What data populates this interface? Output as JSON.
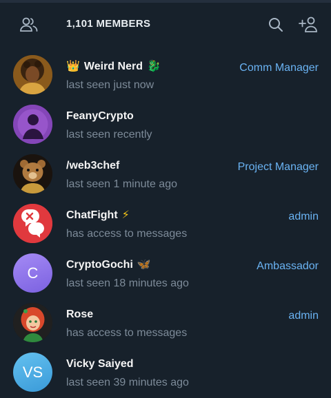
{
  "header": {
    "members_label": "1,101 MEMBERS",
    "icons": [
      "members-icon",
      "search-icon",
      "add-member-icon"
    ]
  },
  "colors": {
    "background": "#17212b",
    "accent": "#6ab3f3",
    "muted": "#7d8b99"
  },
  "members": [
    {
      "prefix_emoji": "👑",
      "name": "Weird Nerd",
      "suffix_emoji": "🐉",
      "status": "last seen just now",
      "role": "Comm Manager",
      "avatar_icon": "portrait-avatar"
    },
    {
      "prefix_emoji": "",
      "name": "FeanyCrypto",
      "suffix_emoji": "",
      "status": "last seen recently",
      "role": "",
      "avatar_icon": "purple-figure-avatar"
    },
    {
      "prefix_emoji": "",
      "name": "/web3chef",
      "suffix_emoji": "",
      "status": "last seen 1 minute ago",
      "role": "Project Manager",
      "avatar_icon": "bear-avatar"
    },
    {
      "prefix_emoji": "",
      "name": "ChatFight",
      "suffix_emoji": "⚡",
      "status": "has access to messages",
      "role": "admin",
      "avatar_icon": "chat-bubbles-logo-avatar"
    },
    {
      "prefix_emoji": "",
      "name": "CryptoGochi",
      "suffix_emoji": "🦋",
      "status": "last seen 18 minutes ago",
      "role": "Ambassador",
      "avatar_initials": "C"
    },
    {
      "prefix_emoji": "",
      "name": "Rose",
      "suffix_emoji": "",
      "status": "has access to messages",
      "role": "admin",
      "avatar_icon": "cartoon-girl-avatar"
    },
    {
      "prefix_emoji": "",
      "name": "Vicky Saiyed",
      "suffix_emoji": "",
      "status": "last seen 39 minutes ago",
      "role": "",
      "avatar_initials": "VS"
    }
  ]
}
